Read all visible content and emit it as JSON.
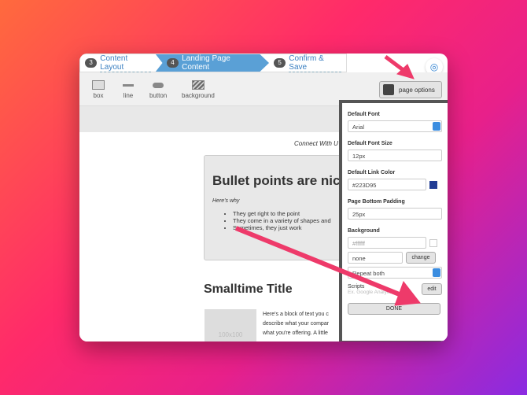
{
  "steps": [
    {
      "num": "3",
      "label": "Content Layout"
    },
    {
      "num": "4",
      "label": "Landing Page Content"
    },
    {
      "num": "5",
      "label": "Confirm & Save"
    }
  ],
  "tools": [
    {
      "label": "box"
    },
    {
      "label": "line"
    },
    {
      "label": "button"
    },
    {
      "label": "background"
    }
  ],
  "page_options_label": "page options",
  "canvas": {
    "connect": "Connect With U",
    "bullet_title": "Bullet points are nice",
    "why": "Here's why",
    "bullets": [
      "They get right to the point",
      "They come in a variety of shapes and",
      "Sometimes, they just work"
    ],
    "small_title": "Smalltime Title",
    "placeholder": "100x100",
    "text_lines": [
      "Here's a block of text you c",
      "describe what your compar",
      "what you're offering. A little"
    ]
  },
  "panel": {
    "font_label": "Default Font",
    "font_value": "Arial",
    "size_label": "Default Font Size",
    "size_value": "12px",
    "link_label": "Default Link Color",
    "link_value": "#223D95",
    "padding_label": "Page Bottom Padding",
    "padding_value": "25px",
    "bg_label": "Background",
    "bg_value": "#ffffff",
    "image_value": "none",
    "change_label": "change",
    "repeat_value": "Repeat both",
    "scripts_label": "Scripts",
    "scripts_hint": "Ex. Google Analytics",
    "edit_label": "edit",
    "done_label": "DONE"
  },
  "colors": {
    "accent": "#5aa0d6",
    "arrow": "#ee3a6a",
    "link_color": "#223D95"
  }
}
